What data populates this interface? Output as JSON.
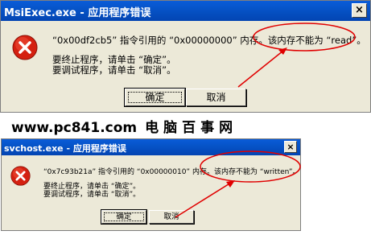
{
  "dialog1": {
    "title": "MsiExec.exe - 应用程序错误",
    "close_glyph": "×",
    "message_line1_a": "“0x00df2cb5” 指令引用的 “0x00000000” 内存。",
    "message_line1_b": "该内存不能为 “read”。",
    "message_line2": "要终止程序，请单击 “确定”。",
    "message_line3": "要调试程序，请单击 “取消”。",
    "ok_label": "确定",
    "cancel_label": "取消"
  },
  "watermark": {
    "url": "www.pc841.com",
    "brand": "电脑百事网"
  },
  "dialog2": {
    "title": "svchost.exe - 应用程序错误",
    "close_glyph": "×",
    "message_line1_a": "“0x7c93b21a” 指令引用的 “0x00000010” 内存。",
    "message_line1_b": "该内存不能为 “written”。",
    "message_line2": "要终止程序，请单击 “确定”。",
    "message_line3": "要调试程序，请单击 “取消”。",
    "ok_label": "确定",
    "cancel_label": "取消"
  },
  "colors": {
    "titlebar": "#0554c6",
    "dialog_face": "#ece9d8",
    "annotation": "#e00000",
    "error_icon": "#d42010"
  },
  "icons": {
    "dialog_icon": "error-icon",
    "close": "close-icon"
  }
}
